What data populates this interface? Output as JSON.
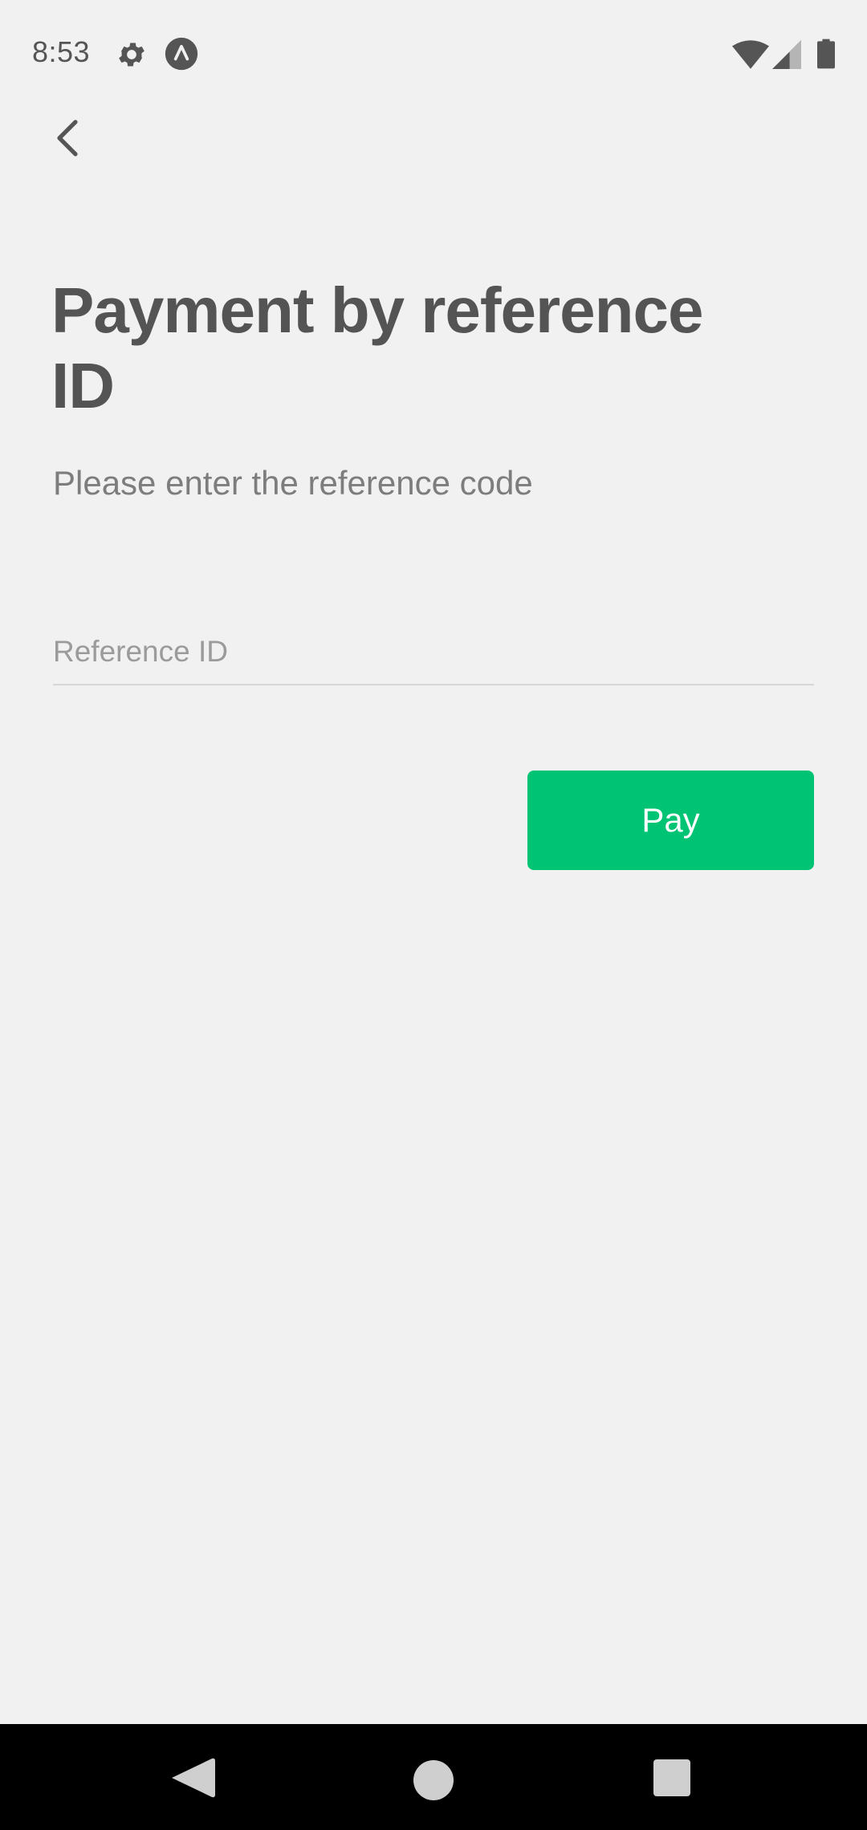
{
  "status_bar": {
    "time": "8:53",
    "icons": [
      "gear-icon",
      "app-notification-icon",
      "wifi-icon",
      "signal-icon",
      "battery-icon"
    ]
  },
  "header": {
    "back_icon": "chevron-left-icon"
  },
  "main": {
    "title": "Payment by reference ID",
    "subtitle": "Please enter the reference code",
    "reference_input": {
      "placeholder": "Reference ID",
      "value": ""
    },
    "pay_button_label": "Pay"
  },
  "nav_bar": {
    "icons": [
      "nav-back-icon",
      "nav-home-icon",
      "nav-recents-icon"
    ]
  },
  "colors": {
    "background": "#f1f1f1",
    "accent": "#00c373",
    "title_text": "#545454",
    "subtitle_text": "#7d7d7d",
    "nav_bar": "#000000"
  }
}
